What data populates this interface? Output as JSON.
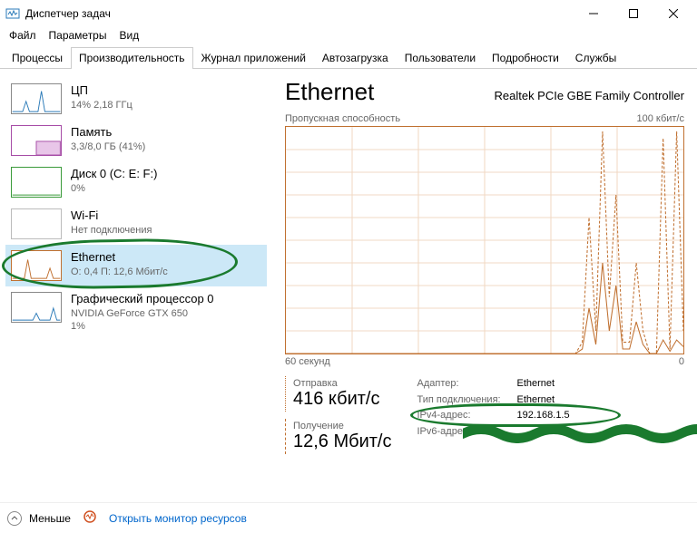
{
  "window": {
    "title": "Диспетчер задач"
  },
  "menu": {
    "file": "Файл",
    "options": "Параметры",
    "view": "Вид"
  },
  "tabs": {
    "processes": "Процессы",
    "performance": "Производительность",
    "apphistory": "Журнал приложений",
    "startup": "Автозагрузка",
    "users": "Пользователи",
    "details": "Подробности",
    "services": "Службы"
  },
  "sidebar": {
    "cpu": {
      "title": "ЦП",
      "sub": "14%  2,18 ГГц"
    },
    "mem": {
      "title": "Память",
      "sub": "3,3/8,0 ГБ (41%)"
    },
    "disk": {
      "title": "Диск 0 (C: E: F:)",
      "sub": "0%"
    },
    "wifi": {
      "title": "Wi-Fi",
      "sub": "Нет подключения"
    },
    "eth": {
      "title": "Ethernet",
      "sub": "О: 0,4 П: 12,6 Мбит/с"
    },
    "gpu": {
      "title": "Графический процессор 0",
      "sub": "NVIDIA GeForce GTX 650",
      "sub2": "1%"
    }
  },
  "main": {
    "title": "Ethernet",
    "adapter_name": "Realtek PCIe GBE Family Controller",
    "chart_label_left": "Пропускная способность",
    "chart_label_right": "100 кбит/с",
    "axis_left": "60 секунд",
    "axis_right": "0",
    "send_label": "Отправка",
    "send_value": "416 кбит/с",
    "recv_label": "Получение",
    "recv_value": "12,6 Мбит/с",
    "kv": {
      "adapter_k": "Адаптер:",
      "adapter_v": "Ethernet",
      "conn_k": "Тип подключения:",
      "conn_v": "Ethernet",
      "ipv4_k": "IPv4-адрес:",
      "ipv4_v": "192.168.1.5",
      "ipv6_k": "IPv6-адрес:",
      "ipv6_v": ""
    }
  },
  "footer": {
    "less": "Меньше",
    "resmon": "Открыть монитор ресурсов"
  },
  "chart_data": {
    "type": "line",
    "xlabel": "60 секунд",
    "ylabel": "",
    "ylim": [
      0,
      100
    ],
    "y_unit": "кбит/с",
    "x_seconds": 60,
    "series": [
      {
        "name": "Получение",
        "style": "dashed",
        "values": [
          0,
          0,
          0,
          0,
          0,
          0,
          0,
          0,
          0,
          0,
          0,
          0,
          0,
          0,
          0,
          0,
          0,
          0,
          0,
          0,
          0,
          0,
          0,
          0,
          0,
          0,
          0,
          0,
          0,
          0,
          0,
          0,
          0,
          0,
          0,
          0,
          0,
          0,
          0,
          0,
          0,
          0,
          0,
          0,
          5,
          60,
          10,
          98,
          25,
          70,
          5,
          5,
          40,
          10,
          0,
          0,
          95,
          2,
          98,
          10
        ]
      },
      {
        "name": "Отправка",
        "style": "solid",
        "values": [
          0,
          0,
          0,
          0,
          0,
          0,
          0,
          0,
          0,
          0,
          0,
          0,
          0,
          0,
          0,
          0,
          0,
          0,
          0,
          0,
          0,
          0,
          0,
          0,
          0,
          0,
          0,
          0,
          0,
          0,
          0,
          0,
          0,
          0,
          0,
          0,
          0,
          0,
          0,
          0,
          0,
          0,
          0,
          0,
          2,
          20,
          4,
          40,
          10,
          30,
          2,
          2,
          14,
          4,
          0,
          0,
          6,
          1,
          6,
          3
        ]
      }
    ]
  }
}
